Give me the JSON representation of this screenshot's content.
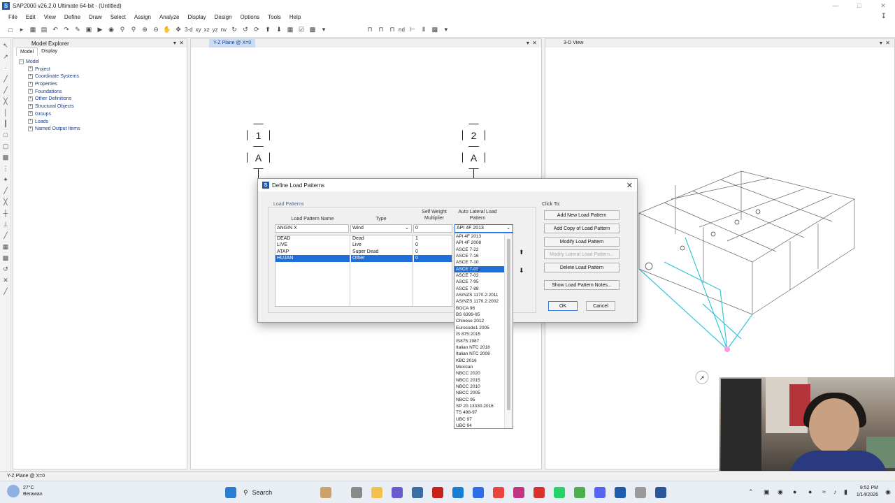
{
  "window": {
    "title": "SAP2000 v26.2.0 Ultimate 64-bit - (Untitled)",
    "app_letter": "S"
  },
  "menu": [
    "File",
    "Edit",
    "View",
    "Define",
    "Draw",
    "Select",
    "Assign",
    "Analyze",
    "Display",
    "Design",
    "Options",
    "Tools",
    "Help"
  ],
  "toolbar_text": {
    "view3d": "3-d",
    "xy": "xy",
    "xz": "xz",
    "yz": "yz",
    "nv": "nv",
    "nd": "nd"
  },
  "explorer": {
    "title": "Model Explorer",
    "tabs": [
      "Model",
      "Display"
    ],
    "root": "Model",
    "items": [
      "Project",
      "Coordinate Systems",
      "Properties",
      "Foundations",
      "Other Definitions",
      "Structural Objects",
      "Groups",
      "Loads",
      "Named Output Items"
    ]
  },
  "views": {
    "left_tab": "Y-Z Plane @ X=0",
    "right_tab": "3-D View",
    "bubbles": [
      {
        "num": "1",
        "letter": "A"
      },
      {
        "num": "2",
        "letter": "A"
      }
    ]
  },
  "dialog": {
    "title": "Define Load Patterns",
    "group_label": "Load Patterns",
    "col_name": "Load Pattern Name",
    "col_type": "Type",
    "col_mult": "Self Weight Multiplier",
    "col_auto": "Auto Lateral Load Pattern",
    "edit": {
      "name": "ANGIN X",
      "type": "Wind",
      "mult": "0",
      "auto": "API 4F 2013"
    },
    "rows": [
      {
        "name": "DEAD",
        "type": "Dead",
        "mult": "1"
      },
      {
        "name": "LIVE",
        "type": "Live",
        "mult": "0"
      },
      {
        "name": "ATAP",
        "type": "Super Dead",
        "mult": "0"
      },
      {
        "name": "HUJAN",
        "type": "Other",
        "mult": "0"
      }
    ],
    "click_to": "Click To:",
    "buttons": {
      "add_new": "Add New Load Pattern",
      "add_copy": "Add Copy of Load Pattern",
      "modify": "Modify Load Pattern",
      "modify_lateral": "Modify Lateral Load Pattern...",
      "delete": "Delete Load Pattern",
      "show_notes": "Show Load Pattern Notes...",
      "ok": "OK",
      "cancel": "Cancel"
    },
    "dropdown_options": [
      "API 4F 2013",
      "API 4F 2008",
      "ASCE 7-22",
      "ASCE 7-16",
      "ASCE 7-10",
      "ASCE 7-05",
      "ASCE 7-02",
      "ASCE 7-95",
      "ASCE 7-88",
      "AS/NZS 1170.2:2011",
      "AS/NZS 1170.2:2002",
      "BOCA 96",
      "BS 6399-95",
      "Chinese 2012",
      "Eurocode1 2005",
      "IS 875:2015",
      "IS875:1987",
      "Italian NTC 2018",
      "Italian NTC 2008",
      "KBC 2016",
      "Mexican",
      "NBCC 2020",
      "NBCC 2015",
      "NBCC 2010",
      "NBCC 2005",
      "NBCC 95",
      "SP 20.13330.2016",
      "TS 498-97",
      "UBC 97",
      "UBC 94"
    ]
  },
  "statusbar": {
    "text": "Y-Z Plane @ X=0"
  },
  "taskbar": {
    "temp": "27°C",
    "weather": "Berawan",
    "search": "Search",
    "time": "9:52 PM",
    "date": "1/14/2026"
  },
  "colors": {
    "selection": "#1e6fd9",
    "accent": "#1e5ba8",
    "frame3d": "#39c6d8"
  }
}
